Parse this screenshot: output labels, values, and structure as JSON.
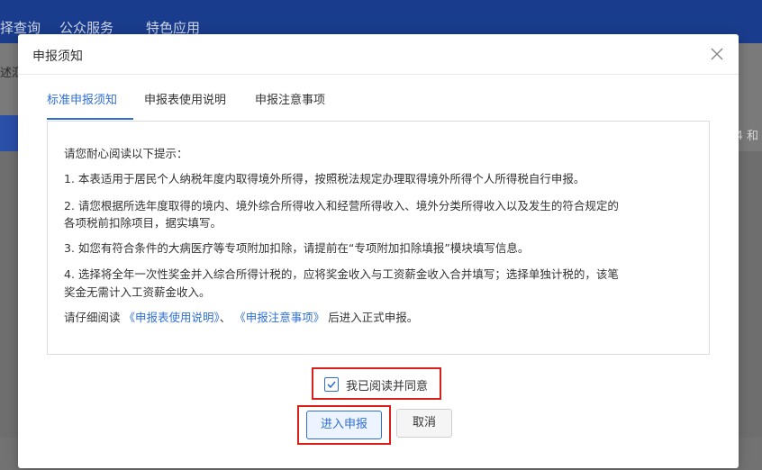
{
  "background": {
    "nav_items": [
      "择查询",
      "公众服务",
      "特色应用"
    ],
    "crumb": "述汇",
    "peek_text": "4 和"
  },
  "modal": {
    "title": "申报须知",
    "tabs": [
      "标准申报须知",
      "申报表使用说明",
      "申报注意事项"
    ],
    "notice": {
      "intro": "请您耐心阅读以下提示：",
      "item1": "1. 本表适用于居民个人纳税年度内取得境外所得，按照税法规定办理取得境外所得个人所得税自行申报。",
      "item2a": "2. 请您根据所选年度取得的境内、境外综合所得收入和经营所得收入、境外分类所得收入以及发生的符合规定的",
      "item2b": "各项税前扣除项目，据实填写。",
      "item3": "3. 如您有符合条件的大病医疗等专项附加扣除，请提前在“专项附加扣除填报”模块填写信息。",
      "item4a": "4. 选择将全年一次性奖金并入综合所得计税的，应将奖金收入与工资薪金收入合并填写；选择单独计税的，该笔",
      "item4b": "奖金无需计入工资薪金收入。",
      "tail_prefix": "请仔细阅读",
      "link1": "《申报表使用说明》",
      "sep": "、",
      "link2": "《申报注意事项》",
      "tail_suffix": "后进入正式申报。"
    },
    "agree_label": "我已阅读并同意",
    "agree_checked": true,
    "enter_button": "进入申报",
    "cancel_button": "取消"
  },
  "colors": {
    "accent": "#2f6fd3",
    "highlight_border": "#d8201a",
    "topbar": "#1a3c8c"
  },
  "icons": {
    "close": "close-icon",
    "check": "check-icon"
  }
}
